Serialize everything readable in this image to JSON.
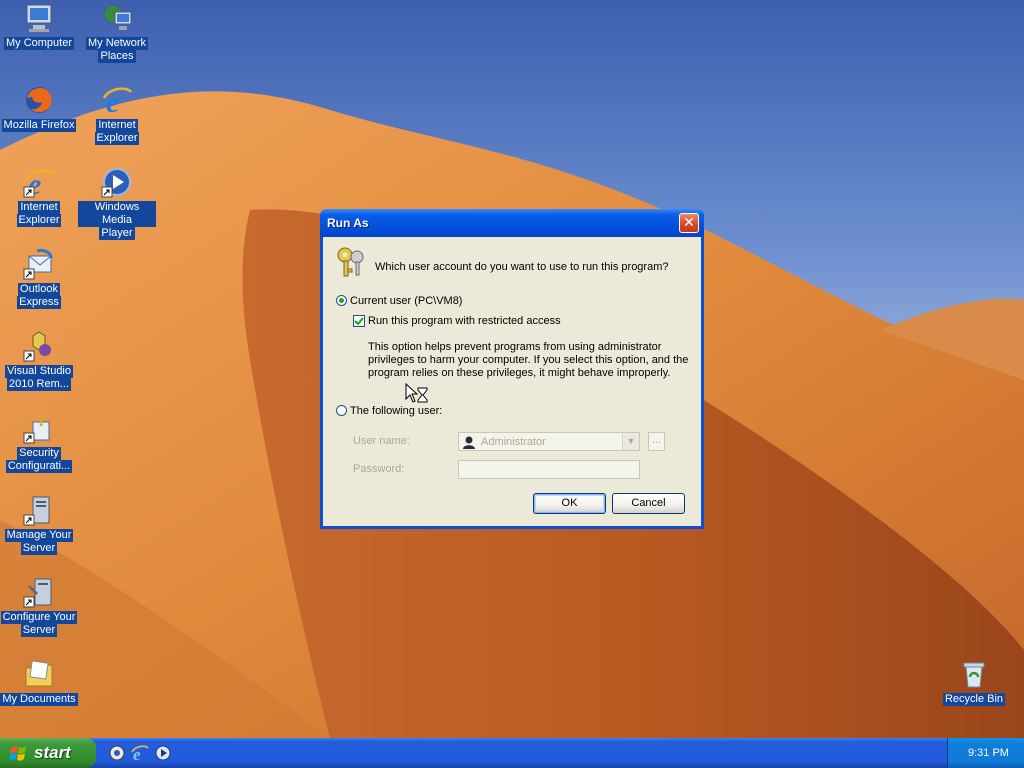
{
  "desktop": {
    "icons": [
      {
        "label_line1": "My Computer",
        "label_line2": "",
        "icon": "computer-icon"
      },
      {
        "label_line1": "My Network",
        "label_line2": "Places",
        "icon": "network-places-icon"
      },
      {
        "label_line1": "Mozilla Firefox",
        "label_line2": "",
        "icon": "firefox-icon"
      },
      {
        "label_line1": "Internet",
        "label_line2": "Explorer",
        "icon": "internet-explorer-icon"
      },
      {
        "label_line1": "Internet",
        "label_line2": "Explorer",
        "icon": "internet-explorer-shortcut-icon"
      },
      {
        "label_line1": "Windows Media",
        "label_line2": "Player",
        "icon": "media-player-icon"
      },
      {
        "label_line1": "Outlook",
        "label_line2": "Express",
        "icon": "outlook-express-icon"
      },
      {
        "label_line1": "Visual Studio",
        "label_line2": "2010 Rem...",
        "icon": "visual-studio-icon"
      },
      {
        "label_line1": "Security",
        "label_line2": "Configurati...",
        "icon": "security-config-icon"
      },
      {
        "label_line1": "Manage Your",
        "label_line2": "Server",
        "icon": "manage-server-icon"
      },
      {
        "label_line1": "Configure Your",
        "label_line2": "Server",
        "icon": "configure-server-icon"
      },
      {
        "label_line1": "My Documents",
        "label_line2": "",
        "icon": "documents-icon"
      },
      {
        "label_line1": "Recycle Bin",
        "label_line2": "",
        "icon": "recycle-bin-icon"
      }
    ]
  },
  "dialog": {
    "title": "Run As",
    "question": "Which user account do you want to use to run this program?",
    "current_user_label": "Current user (PC\\VM8)",
    "restricted_label": "Run this program with restricted access",
    "description_line1": "This option helps prevent programs from using administrator",
    "description_line2": "privileges to harm your computer.  If you select this option, and the",
    "description_line3": "program relies on these privileges, it might behave improperly.",
    "following_user_label": "The following user:",
    "username_label": "User name:",
    "username_value": "Administrator",
    "password_label": "Password:",
    "password_value": "",
    "browse_label": "...",
    "ok_label": "OK",
    "cancel_label": "Cancel",
    "current_user_selected": true,
    "restricted_checked": true
  },
  "taskbar": {
    "start_label": "start",
    "clock": "9:31 PM"
  },
  "colors": {
    "taskbar_blue": "#245ddb",
    "start_green": "#3c9a3a",
    "dialog_bg": "#ece9d8",
    "title_blue": "#0551de"
  }
}
